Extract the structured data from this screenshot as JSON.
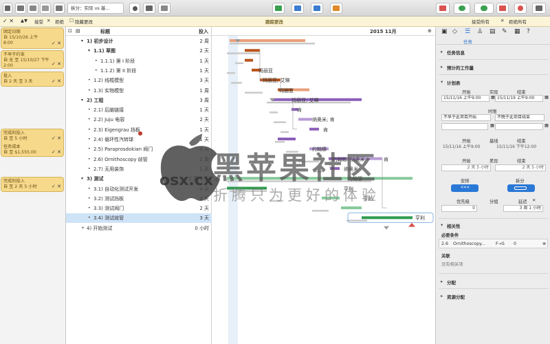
{
  "toolbar": {
    "baseline_select": "拆分：实际 vs 基...",
    "icons": [
      "view-icon",
      "outline-icon",
      "gantt-icon",
      "split-icon",
      "layout-icon",
      "person-icon",
      "resource-icon",
      "add-icon",
      "indent-icon",
      "outdent-icon",
      "link-icon",
      "camera-icon"
    ]
  },
  "subbar": {
    "accept": "接受",
    "reject": "拒绝",
    "hide_changes": "隐藏更改",
    "track_changes": "跟踪更改",
    "accept_all": "接受所有",
    "reject_all": "拒绝所有"
  },
  "changes": [
    {
      "line1": "固定日期",
      "line2": "自 15/10/26 上午",
      "line3": "8:00"
    },
    {
      "line1": "不早于约束",
      "line2": "自 无 至 15/10/27 下午",
      "line3": "2:00"
    },
    {
      "line1": "投入",
      "line2": "自 2 天 至 3 天",
      "line3": ""
    },
    {
      "line1": "完成的投入",
      "line2": "自 至 5 小时",
      "line3": ""
    },
    {
      "line1": "任务成本",
      "line2": "自 至 $1,555.00",
      "line3": ""
    },
    {
      "line1": "完成的投入",
      "line2": "自 至 2 天 5 小时",
      "line3": ""
    }
  ],
  "outline": {
    "col_title": "标题",
    "col_effort": "投入",
    "rows": [
      {
        "title": "1)  初步设计",
        "effort": "2 周",
        "level": 0,
        "bold": true
      },
      {
        "title": "1.1)  草图",
        "effort": "2 天",
        "level": 1,
        "bold": true
      },
      {
        "title": "1.1.1)  第 I 阶段",
        "effort": "1 天",
        "level": 2,
        "bold": false
      },
      {
        "title": "1.1.2)  第 II 阶段",
        "effort": "1 天",
        "level": 2,
        "bold": false
      },
      {
        "title": "1.2)  线框模型",
        "effort": "3 天",
        "level": 1,
        "bold": false
      },
      {
        "title": "1.3)  实物模型",
        "effort": "1 周",
        "level": 1,
        "bold": false
      },
      {
        "title": "2)  工程",
        "effort": "3 周",
        "level": 0,
        "bold": true
      },
      {
        "title": "2.1)  后脑链接",
        "effort": "1 天",
        "level": 1,
        "bold": false
      },
      {
        "title": "2.2)  Juju 电容",
        "effort": "2 天",
        "level": 1,
        "bold": false
      },
      {
        "title": "2.3)  Eigengrau 挡板",
        "effort": "1 天",
        "level": 1,
        "bold": false
      },
      {
        "title": "2.4)  循环性汽转球",
        "effort": "1 天",
        "level": 1,
        "bold": false
      },
      {
        "title": "2.5)  Paraprosdokian 阀门",
        "effort": "4 天",
        "level": 1,
        "bold": false
      },
      {
        "title": "2.6)  Ornithoscopy 歧管",
        "effort": "1 周",
        "level": 1,
        "bold": false
      },
      {
        "title": "2.7)  无用装饰",
        "effort": "1 天",
        "level": 1,
        "bold": false
      },
      {
        "title": "3)  测试",
        "effort": "2 周 1 天",
        "level": 0,
        "bold": true
      },
      {
        "title": "3.1)  自动化测试开发",
        "effort": "4 天",
        "level": 1,
        "bold": false
      },
      {
        "title": "3.2)  测试挡板",
        "effort": "2 天",
        "level": 1,
        "bold": false
      },
      {
        "title": "3.3)  测试阀门",
        "effort": "2 天",
        "level": 1,
        "bold": false
      },
      {
        "title": "3.4)  测试歧管",
        "effort": "3 天",
        "level": 1,
        "bold": false,
        "selected": true
      },
      {
        "title": "4)  开始测试",
        "effort": "0 小时",
        "level": 0,
        "bold": false
      }
    ]
  },
  "gantt": {
    "header_title": "跟踪更改",
    "month": "2015 11月",
    "labels": [
      "玛丽亚",
      "玛丽亚; 艾琳",
      "玛丽亚",
      "玛丽亚; 艾琳",
      "肯",
      "纳奥米; 肯",
      "肯",
      "约翰娜",
      "约翰娜; 纳奥米",
      "肯",
      "纳奥米",
      "约翰娜",
      "亨利",
      "亨利",
      "亨利"
    ]
  },
  "inspector": {
    "tab_label": "任务",
    "task_info": "任务信息",
    "estimated_effort": "预计的工作量",
    "schedule": "计划表",
    "start": "开始",
    "actual": "实际",
    "end": "结束",
    "start_val": "15/11/16 上午9:00",
    "end_val": "15/11/19 上午9:00",
    "limit": "时限",
    "limit_start": "不早于此项目开始",
    "limit_end": "不晚于此项目结束",
    "start2": "开始",
    "baseline": "基线",
    "end2": "结束",
    "baseline_start": "15/11/16 上午9:00",
    "baseline_end": "15/11/16 下午12:00",
    "start3": "开始",
    "variance": "差异",
    "end3": "结束",
    "variance_start": "2 天 5 小时",
    "variance_end": "2 天 5 小时",
    "leveling": "安排",
    "split": "拆分",
    "priority": "优先级",
    "priority_val": "0",
    "grouping": "分组",
    "delay": "延迟",
    "delay_val": "3 周 1 小时",
    "relations": "相关性",
    "prerequisites": "必要条件",
    "prereq_id": "2.6",
    "prereq_name": "Ornithoscopy...",
    "prereq_type": "F→S",
    "prereq_lag": "0",
    "links": "关联",
    "no_links": "没有相关项",
    "splits": "分配",
    "resources": "资源分配"
  },
  "watermark": {
    "brand": "黑苹果社区",
    "domain": "osx.cx",
    "slogan": "折腾只为更好的体验"
  },
  "colors": {
    "brown": "#b8541b",
    "salmon": "#e8a07a",
    "purple": "#8b5fb8",
    "lavender": "#b79ad6",
    "green": "#2f9a4f",
    "lightgreen": "#87c99b",
    "grey": "#c9c9c9",
    "card": "#f6d98b"
  }
}
